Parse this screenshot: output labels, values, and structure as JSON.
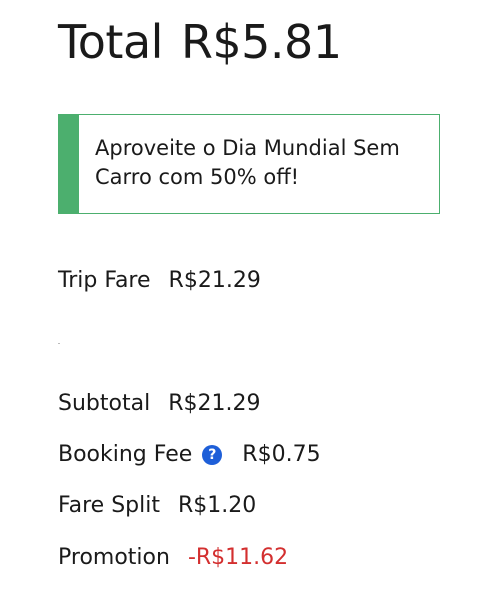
{
  "total": {
    "label": "Total",
    "amount": "R$5.81"
  },
  "promo_banner": {
    "text": "Aproveite o Dia Mundial Sem Carro com 50% off!",
    "accent_color": "#4caf6e"
  },
  "trip_fare": {
    "label": "Trip Fare",
    "value": "R$21.29"
  },
  "breakdown": {
    "subtotal": {
      "label": "Subtotal",
      "value": "R$21.29"
    },
    "booking_fee": {
      "label": "Booking Fee",
      "value": "R$0.75",
      "icon": "help-icon",
      "icon_glyph": "?"
    },
    "fare_split": {
      "label": "Fare Split",
      "value": "R$1.20"
    },
    "promotion": {
      "label": "Promotion",
      "value": "-R$11.62",
      "value_color": "#d32f2f"
    }
  }
}
